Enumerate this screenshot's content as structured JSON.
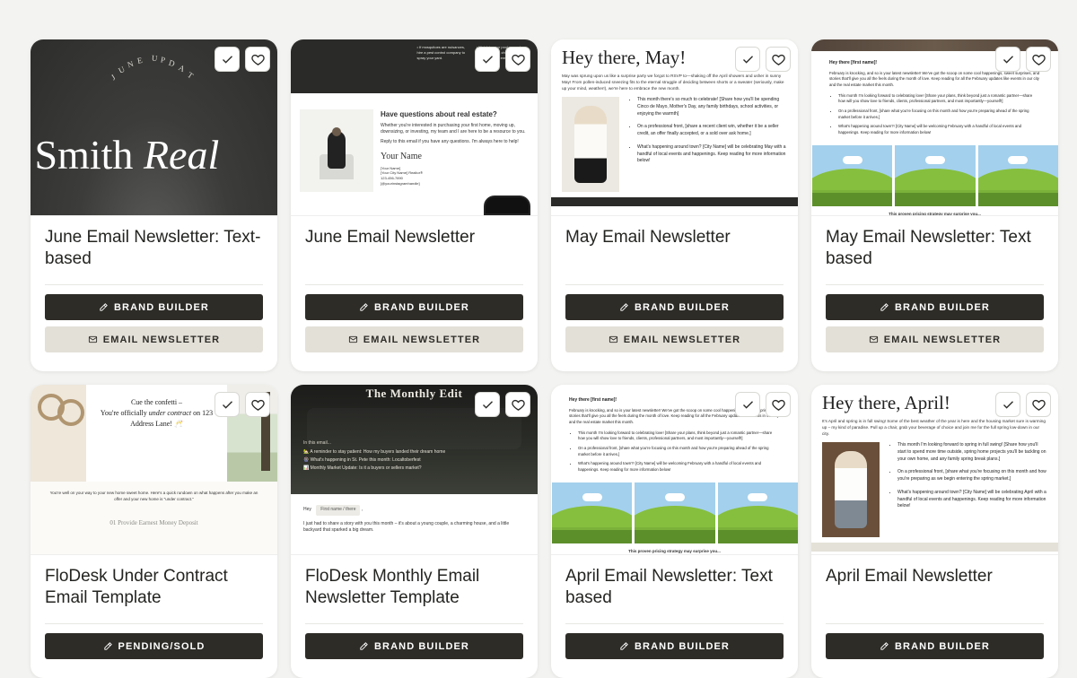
{
  "actions": {
    "check_label": "Select",
    "heart_label": "Favorite"
  },
  "buttons": {
    "brand_builder": "BRAND BUILDER",
    "email_newsletter": "EMAIL NEWSLETTER",
    "pending_sold": "PENDING/SOLD"
  },
  "cards": [
    {
      "title": "June Email Newsletter: Text-based",
      "btn1": "BRAND BUILDER",
      "btn2": "EMAIL NEWSLETTER",
      "thumb": {
        "arc": "JUNE UPDATE",
        "hero_left": "n Smith ",
        "hero_em": "Real"
      }
    },
    {
      "title": "June Email Newsletter",
      "btn1": "BRAND BUILDER",
      "btn2": "EMAIL NEWSLETTER",
      "thumb": {
        "hdr_col3_1": "If mosquitoes are nuisances, hire a pest control company to spray your yard.",
        "hdr_col4_1": "Maintain your pool or spa by cleaning filters, checking chemistry, and ensuring filtration.",
        "heading": "Have questions about real estate?",
        "para1": "Whether you're interested in purchasing your first home, moving up, downsizing, or investing, my team and I are here to be a resource to you.",
        "para2": "Reply to this email if you have any questions. I'm always here to help!",
        "sig": "Your Name",
        "meta1": "[Your Name]",
        "meta2": "[Your City Name] Realtor®",
        "meta3": "123-456-7890",
        "meta4": "[@yourinstagramhandle]"
      }
    },
    {
      "title": "May Email Newsletter",
      "btn1": "BRAND BUILDER",
      "btn2": "EMAIL NEWSLETTER",
      "thumb": {
        "script": "Hey there, May!",
        "intro": "May was sprung upon us like a surprise party we forgot to RSVP to—shaking off the April showers and usher in sunny May! From pollen-induced sneezing fits to the eternal struggle of deciding between shorts or a sweater (seriously, make up your mind, weather!), we're here to embrace the new month.",
        "b1": "This month there's so much to celebrate! [Share how you'll be spending Cinco de Mayo, Mother's Day, any family birthdays, school activities, or enjoying the warmth]",
        "b2": "On a professional front, [share a recent client win, whether it be a seller credit, an offer finally accepted, or a sold over ask home.]",
        "b3": "What's happening around town? [City Name] will be celebrating May with a handful of local events and happenings. Keep reading for more information below!"
      }
    },
    {
      "title": "May Email Newsletter: Text based",
      "btn1": "BRAND BUILDER",
      "btn2": "EMAIL NEWSLETTER",
      "thumb": {
        "hey": "Hey there [first name]!",
        "para": "February is knocking, and so is your latest newsletter! We've got the scoop on some cool happenings, sweet surprises, and stories that'll give you all the feels during the month of love. Keep reading for all the February updates like events in our city and the real estate market this month.",
        "b1": "This month I'm looking forward to celebrating love! [Share your plans, think beyond just a romantic partner—share how will you show love to friends, clients, professional partners, and most importantly—yourself!]",
        "b2": "On a professional front, [share what you're focusing on this month and how you're preparing ahead of the spring market before it arrives.]",
        "b3": "What's happening around town?! [City Name] will be welcoming February with a handful of local events and happenings. Keep reading for more information below!",
        "cap": "This proven pricing strategy may surprise you..."
      }
    },
    {
      "title": "FloDesk Under Contract Email Template",
      "btn1": "PENDING/SOLD",
      "btn2": "",
      "thumb": {
        "cta1": "Cue the confetti –",
        "cta2_a": "You're officially ",
        "cta2_em": "under contract",
        "cta2_b": " on 123 Address Lane! 🥂",
        "note": "You're well on your way to your new home sweet home. Here's a quick rundown on what happens after you make an offer and your new home is \"under contract.\"",
        "foot": "01 Provide Earnest Money Deposit"
      }
    },
    {
      "title": "FloDesk Monthly Email Newsletter Template",
      "btn1": "BRAND BUILDER",
      "btn2": "",
      "thumb": {
        "title": "The Monthly Edit",
        "sub": "In this email...",
        "li1": "🏡 A reminder to stay patient: How my buyers landed their dream home",
        "li2": "🎡 What's happening in St. Pete this month: Localtoberfest",
        "li3": "📊 Monthly Market Update: Is it a buyers or sellers market?",
        "hey": "Hey",
        "chip": "First name / there",
        "p": "I just had to share a story with you this month – it's about a young couple, a charming house, and a little backyard that sparked a big dream."
      }
    },
    {
      "title": "April Email Newsletter: Text based",
      "btn1": "BRAND BUILDER",
      "btn2": "",
      "thumb": {
        "hey": "Hey there [first name]!",
        "para": "February is knocking, and so is your latest newsletter! We've got the scoop on some cool happenings, sweet surprises, and stories that'll give you all the feels during the month of love. Keep reading for all the February updates like events in our city and the real estate market this month.",
        "b1": "This month I'm looking forward to celebrating love! [Share your plans, think beyond just a romantic partner—share how you will show love to friends, clients, professional partners, and most importantly—yourself!]",
        "b2": "On a professional front, [share what you're focusing on this month and how you're preparing ahead of the spring market before it arrives.]",
        "b3": "What's happening around town?! [City Name] will be welcoming February with a handful of local events and happenings. Keep reading for more information below!",
        "cap": "This proven pricing strategy may surprise you..."
      }
    },
    {
      "title": "April Email Newsletter",
      "btn1": "BRAND BUILDER",
      "btn2": "",
      "thumb": {
        "script": "Hey there, April!",
        "intro": "It's April and spring is in full swing! Some of the best weather of the year is here and the housing market sure is warming up – my kind of paradise. Pull up a chair, grab your beverage of choice and join me for the full spring low-down in our city.",
        "b1": "This month I'm looking forward to spring in full swing! [Share how you'll start to spend more time outside, spring home projects you'll be tackling on your own home, and any family spring break plans.]",
        "b2": "On a professional front, [share what you're focusing on this month and how you're preparing as we begin entering the spring market.]",
        "b3": "What's happening around town? [City Name] will be celebrating April with a handful of local events and happenings. Keep reading for more information below!"
      }
    }
  ]
}
